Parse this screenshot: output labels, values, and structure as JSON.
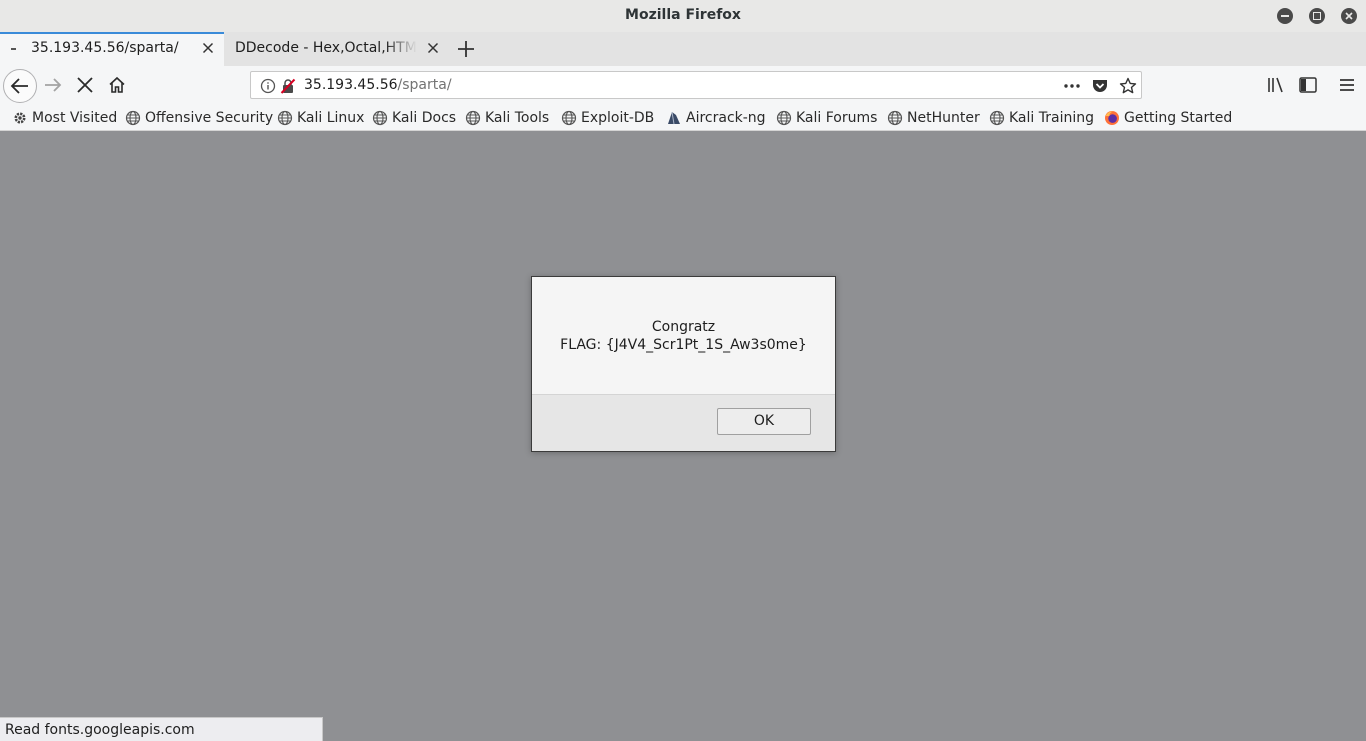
{
  "window": {
    "title": "Mozilla Firefox"
  },
  "tabs": [
    {
      "label": "35.193.45.56/sparta/",
      "active": true
    },
    {
      "label": "DDecode - Hex,Octal,HTML",
      "active": false
    }
  ],
  "urlbar": {
    "host": "35.193.45.56",
    "path": "/sparta/"
  },
  "bookmarks": [
    {
      "label": "Most Visited",
      "icon": "gear-icon"
    },
    {
      "label": "Offensive Security",
      "icon": "globe-icon"
    },
    {
      "label": "Kali Linux",
      "icon": "globe-icon"
    },
    {
      "label": "Kali Docs",
      "icon": "globe-icon"
    },
    {
      "label": "Kali Tools",
      "icon": "globe-icon"
    },
    {
      "label": "Exploit-DB",
      "icon": "globe-icon"
    },
    {
      "label": "Aircrack-ng",
      "icon": "aircrack-icon"
    },
    {
      "label": "Kali Forums",
      "icon": "globe-icon"
    },
    {
      "label": "NetHunter",
      "icon": "globe-icon"
    },
    {
      "label": "Kali Training",
      "icon": "globe-icon"
    },
    {
      "label": "Getting Started",
      "icon": "firefox-icon"
    }
  ],
  "dialog": {
    "line1": "Congratz",
    "line2": "FLAG: {J4V4_Scr1Pt_1S_Aw3s0me}",
    "ok_label": "OK"
  },
  "status": {
    "text": "Read fonts.googleapis.com"
  },
  "colors": {
    "accent": "#3a8bd9",
    "content_bg": "#8f9093",
    "dialog_bg": "#f5f5f5"
  }
}
